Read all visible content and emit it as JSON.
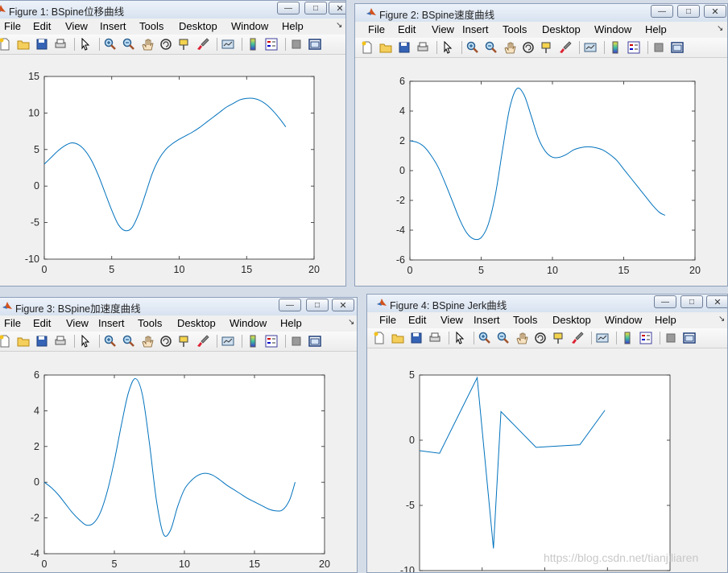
{
  "figures": [
    {
      "title": "Figure 1: BSpine位移曲线",
      "chart_data": {
        "type": "line",
        "x": [
          0,
          0.5,
          1,
          1.5,
          2,
          2.5,
          3,
          3.5,
          4,
          4.5,
          5,
          5.5,
          6,
          6.5,
          7,
          7.5,
          8,
          8.5,
          9,
          9.5,
          10,
          10.5,
          11,
          11.5,
          12,
          12.5,
          13,
          13.5,
          14,
          14.5,
          15,
          15.5,
          16,
          16.5,
          17,
          17.5,
          17.9
        ],
        "series": [
          {
            "values": [
              3,
              3.9,
              4.8,
              5.5,
              5.9,
              5.7,
              4.9,
              3.5,
              1.5,
              -0.9,
              -3.3,
              -5.3,
              -6.1,
              -5.7,
              -3.8,
              -1.1,
              1.7,
              3.7,
              5.0,
              5.8,
              6.4,
              6.9,
              7.4,
              8.0,
              8.7,
              9.4,
              10.1,
              10.8,
              11.3,
              11.8,
              12.0,
              12.0,
              11.7,
              11.1,
              10.2,
              9.1,
              8.1
            ]
          }
        ],
        "xlim": [
          0,
          20
        ],
        "ylim": [
          -10,
          15
        ],
        "xticks": [
          "0",
          "5",
          "10",
          "15",
          "20"
        ],
        "yticks": [
          "-10",
          "-5",
          "0",
          "5",
          "10",
          "15"
        ],
        "color": "#0072bd"
      }
    },
    {
      "title": "Figure 2: BSpine速度曲线",
      "chart_data": {
        "type": "line",
        "x": [
          0,
          0.5,
          1,
          1.5,
          2,
          2.5,
          3,
          3.5,
          4,
          4.5,
          5,
          5.5,
          6,
          6.5,
          7,
          7.5,
          8,
          8.5,
          9,
          9.5,
          10,
          10.5,
          11,
          11.5,
          12,
          12.5,
          13,
          13.5,
          14,
          14.5,
          15,
          15.5,
          16,
          16.5,
          17,
          17.5,
          17.9
        ],
        "series": [
          {
            "values": [
              2.0,
              1.9,
              1.6,
              1.0,
              0.2,
              -0.9,
              -2.1,
              -3.3,
              -4.2,
              -4.6,
              -4.5,
              -3.6,
              -1.6,
              1.4,
              4.2,
              5.5,
              5.1,
              3.7,
              2.2,
              1.3,
              0.9,
              0.9,
              1.1,
              1.4,
              1.55,
              1.6,
              1.55,
              1.4,
              1.1,
              0.7,
              0.1,
              -0.5,
              -1.1,
              -1.7,
              -2.3,
              -2.8,
              -3.0
            ]
          }
        ],
        "xlim": [
          0,
          20
        ],
        "ylim": [
          -6,
          6
        ],
        "xticks": [
          "0",
          "5",
          "10",
          "15",
          "20"
        ],
        "yticks": [
          "-6",
          "-4",
          "-2",
          "0",
          "2",
          "4",
          "6"
        ],
        "color": "#0072bd"
      }
    },
    {
      "title": "Figure 3: BSpine加速度曲线",
      "chart_data": {
        "type": "line",
        "x": [
          0,
          0.5,
          1,
          1.5,
          2,
          2.5,
          3,
          3.5,
          4,
          4.5,
          5,
          5.5,
          6,
          6.5,
          7,
          7.5,
          8,
          8.5,
          9,
          9.5,
          10,
          10.5,
          11,
          11.5,
          12,
          12.5,
          13,
          13.5,
          14,
          14.5,
          15,
          15.5,
          16,
          16.5,
          17,
          17.5,
          17.9
        ],
        "series": [
          {
            "values": [
              0,
              -0.3,
              -0.7,
              -1.2,
              -1.7,
              -2.1,
              -2.4,
              -2.3,
              -1.7,
              -0.5,
              1.2,
              3.2,
              5.0,
              5.8,
              4.9,
              2.2,
              -1.0,
              -2.9,
              -2.7,
              -1.4,
              -0.4,
              0.1,
              0.4,
              0.5,
              0.4,
              0.15,
              -0.15,
              -0.4,
              -0.65,
              -0.9,
              -1.1,
              -1.3,
              -1.5,
              -1.6,
              -1.55,
              -1.0,
              0
            ]
          }
        ],
        "xlim": [
          0,
          20
        ],
        "ylim": [
          -4,
          6
        ],
        "xticks": [
          "0",
          "5",
          "10",
          "15",
          "20"
        ],
        "yticks": [
          "-4",
          "-2",
          "0",
          "2",
          "4",
          "6"
        ],
        "color": "#0072bd"
      }
    },
    {
      "title": "Figure 4: BSpine Jerk曲线",
      "chart_data": {
        "type": "line",
        "x": [
          0,
          1.6,
          4.6,
          5.9,
          6.5,
          9.3,
          12.8,
          14.8
        ],
        "series": [
          {
            "values": [
              -0.8,
              -1.0,
              4.8,
              -8.3,
              2.2,
              -0.55,
              -0.35,
              2.3
            ]
          }
        ],
        "xlim": [
          0,
          20
        ],
        "ylim": [
          -10,
          5
        ],
        "xticks": [],
        "yticks": [
          "-10",
          "-5",
          "0",
          "5"
        ],
        "color": "#0072bd"
      }
    }
  ],
  "menu": [
    "File",
    "Edit",
    "View",
    "Insert",
    "Tools",
    "Desktop",
    "Window",
    "Help"
  ],
  "dock_glyph": "↘",
  "window_buttons": {
    "minimize": "—",
    "maximize": "□",
    "close": "✕"
  },
  "watermark": "https://blog.csdn.net/tianjiliaren"
}
